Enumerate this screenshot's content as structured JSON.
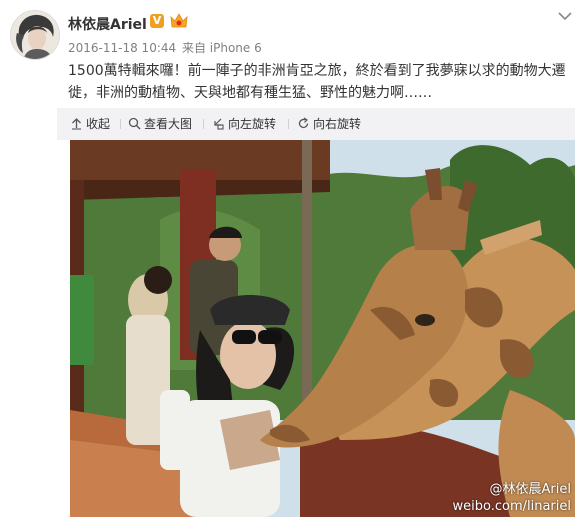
{
  "post": {
    "username": "林依晨Ariel",
    "verified_mark": "V",
    "timestamp": "2016-11-18 10:44",
    "source": "来自 iPhone 6",
    "text": "1500萬特輯來囉！前一陣子的非洲肯亞之旅，終於看到了我夢寐以求的動物大遷徙，非洲的動植物、天與地都有種生猛、野性的魅力啊……"
  },
  "toolbar": {
    "collapse_label": "收起",
    "view_large_label": "查看大图",
    "rotate_left_label": "向左旋转",
    "rotate_right_label": "向右旋转"
  },
  "photo": {
    "watermark_line1": "@林依晨Ariel",
    "watermark_line2": "weibo.com/linariel"
  },
  "icons": {
    "collapse": "arrow-up-icon",
    "view_large": "magnifier-icon",
    "rotate_left": "rotate-left-icon",
    "rotate_right": "rotate-right-icon",
    "menu": "chevron-down-icon"
  },
  "colors": {
    "verified": "#f0a020",
    "toolbar_bg": "#f2f2f5",
    "meta_text": "#808080"
  }
}
